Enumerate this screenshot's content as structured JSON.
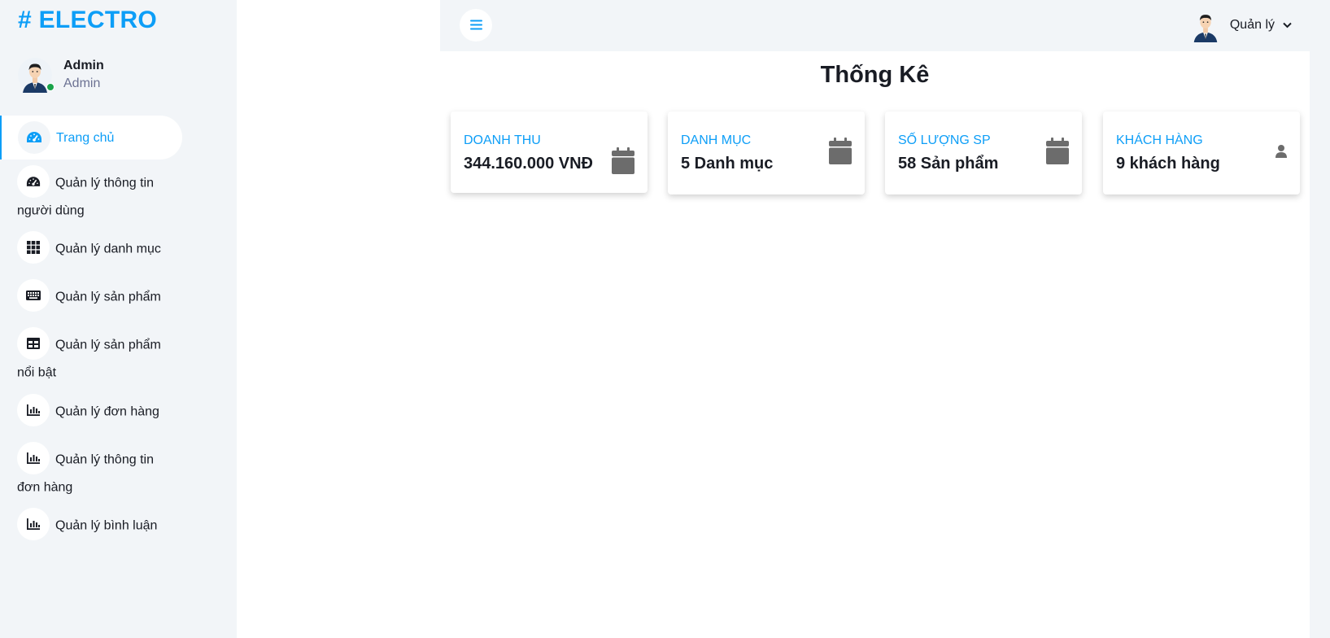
{
  "brand": {
    "title": "# ELECTRO",
    "color": "#0d9ef7"
  },
  "profile": {
    "name": "Admin",
    "role": "Admin",
    "status": "online"
  },
  "sidebar": {
    "items": [
      {
        "label": "Trang chủ",
        "icon": "speedometer-icon",
        "active": true
      },
      {
        "label": "Quản lý thông tin người dùng",
        "icon": "speedometer-icon"
      },
      {
        "label": "Quản lý danh mục",
        "icon": "grid-icon"
      },
      {
        "label": "Quản lý sản phẩm",
        "icon": "keyboard-icon"
      },
      {
        "label": "Quản lý sản phẩm nổi bật",
        "icon": "table-icon"
      },
      {
        "label": "Quản lý đơn hàng",
        "icon": "bar-chart-icon"
      },
      {
        "label": "Quản lý thông tin đơn hàng",
        "icon": "bar-chart-icon"
      },
      {
        "label": "Quản lý bình luận",
        "icon": "bar-chart-icon"
      }
    ]
  },
  "topbar": {
    "user_label": "Quản lý",
    "toggle_icon": "hamburger-icon"
  },
  "main": {
    "title": "Thống Kê",
    "cards": [
      {
        "label": "DOANH THU",
        "value": "344.160.000 VNĐ",
        "icon": "calendar-icon"
      },
      {
        "label": "DANH MỤC",
        "value": "5 Danh mục",
        "icon": "calendar-icon"
      },
      {
        "label": "SỐ LƯỢNG SP",
        "value": "58 Sản phẩm",
        "icon": "calendar-icon"
      },
      {
        "label": "KHÁCH HÀNG",
        "value": "9 khách hàng",
        "icon": "user-icon"
      }
    ]
  },
  "colors": {
    "accent": "#0d9ef7",
    "sidebar_bg": "#f2f5f8",
    "online": "#1aa34a",
    "icon_gray": "#6c6c6c"
  }
}
